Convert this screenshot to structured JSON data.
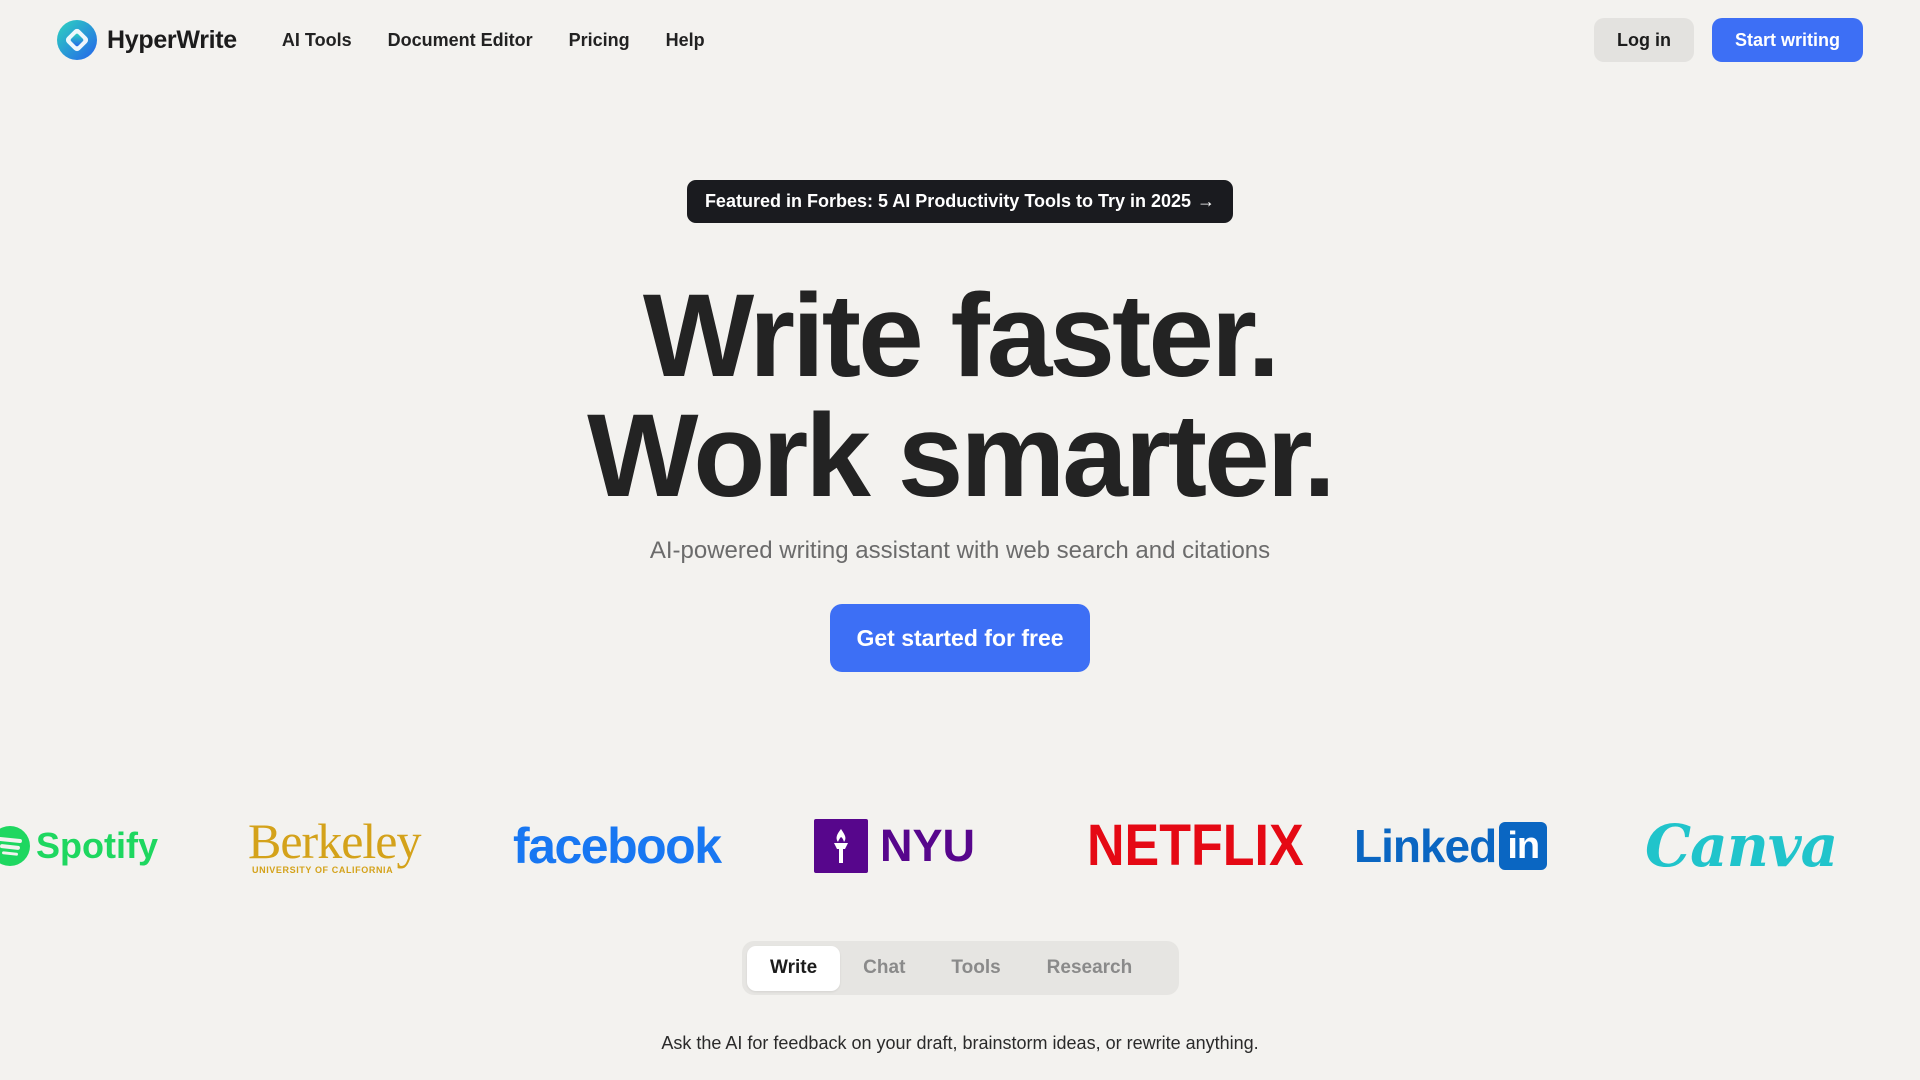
{
  "nav": {
    "brand": "HyperWrite",
    "links": [
      "AI Tools",
      "Document Editor",
      "Pricing",
      "Help"
    ],
    "login_label": "Log in",
    "start_label": "Start writing"
  },
  "hero": {
    "featured": "Featured in Forbes: 5 AI Productivity Tools to Try in 2025",
    "featured_arrow": "→",
    "headline_line1": "Write faster.",
    "headline_line2": "Work smarter.",
    "subheadline": "AI-powered writing assistant with web search and citations",
    "cta_label": "Get started for free"
  },
  "logos": {
    "spotify": "Spotify",
    "berkeley": "Berkeley",
    "berkeley_sub": "UNIVERSITY OF CALIFORNIA",
    "facebook": "facebook",
    "nyu": "NYU",
    "netflix": "NETFLIX",
    "linkedin": "Linked",
    "linkedin_in": "in",
    "canva": "Canva"
  },
  "tabs": {
    "items": [
      "Write",
      "Chat",
      "Tools",
      "Research"
    ],
    "active": "Write",
    "description": "Ask the AI for feedback on your draft, brainstorm ideas, or rewrite anything."
  },
  "colors": {
    "accent": "#3d6ff5",
    "background": "#f3f2ef",
    "featured_bg": "#1a1b1f"
  }
}
